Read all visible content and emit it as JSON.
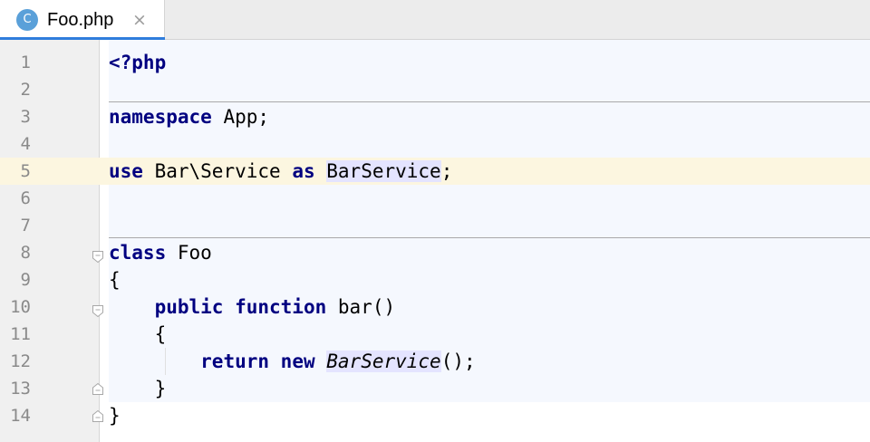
{
  "tab": {
    "icon_letter": "C",
    "filename": "Foo.php",
    "close_glyph": "×",
    "icon_color": "#5aa0d9",
    "underline_color": "#2f7ddc"
  },
  "editor": {
    "current_line": 5,
    "lines": [
      {
        "no": "1",
        "tokens": [
          {
            "t": "<?php",
            "kw": true
          }
        ]
      },
      {
        "no": "2",
        "tokens": []
      },
      {
        "no": "3",
        "tokens": [
          {
            "t": "namespace",
            "kw": true
          },
          {
            "t": " App;"
          }
        ]
      },
      {
        "no": "4",
        "tokens": []
      },
      {
        "no": "5",
        "tokens": [
          {
            "t": "use",
            "kw": true
          },
          {
            "t": " Bar\\Service "
          },
          {
            "t": "as",
            "kw": true
          },
          {
            "t": " "
          },
          {
            "t": "BarService",
            "hl": true
          },
          {
            "t": ";"
          }
        ]
      },
      {
        "no": "6",
        "tokens": []
      },
      {
        "no": "7",
        "tokens": []
      },
      {
        "no": "8",
        "tokens": [
          {
            "t": "class",
            "kw": true
          },
          {
            "t": " Foo"
          }
        ]
      },
      {
        "no": "9",
        "tokens": [
          {
            "t": "{"
          }
        ]
      },
      {
        "no": "10",
        "tokens": [
          {
            "t": "    "
          },
          {
            "t": "public",
            "kw": true
          },
          {
            "t": " "
          },
          {
            "t": "function",
            "kw": true
          },
          {
            "t": " bar()"
          }
        ]
      },
      {
        "no": "11",
        "tokens": [
          {
            "t": "    {"
          }
        ]
      },
      {
        "no": "12",
        "tokens": [
          {
            "t": "        "
          },
          {
            "t": "return",
            "kw": true
          },
          {
            "t": " "
          },
          {
            "t": "new",
            "kw": true
          },
          {
            "t": " "
          },
          {
            "t": "BarService",
            "hl": true,
            "italic": true
          },
          {
            "t": "();"
          }
        ]
      },
      {
        "no": "13",
        "tokens": [
          {
            "t": "    }"
          }
        ]
      },
      {
        "no": "14",
        "tokens": [
          {
            "t": "}"
          }
        ]
      }
    ],
    "colors": {
      "keyword": "#000080",
      "caret_row": "#fcf6e0",
      "identifier_highlight": "#e4e4ff",
      "scope_background": "#f5f8fe"
    }
  }
}
